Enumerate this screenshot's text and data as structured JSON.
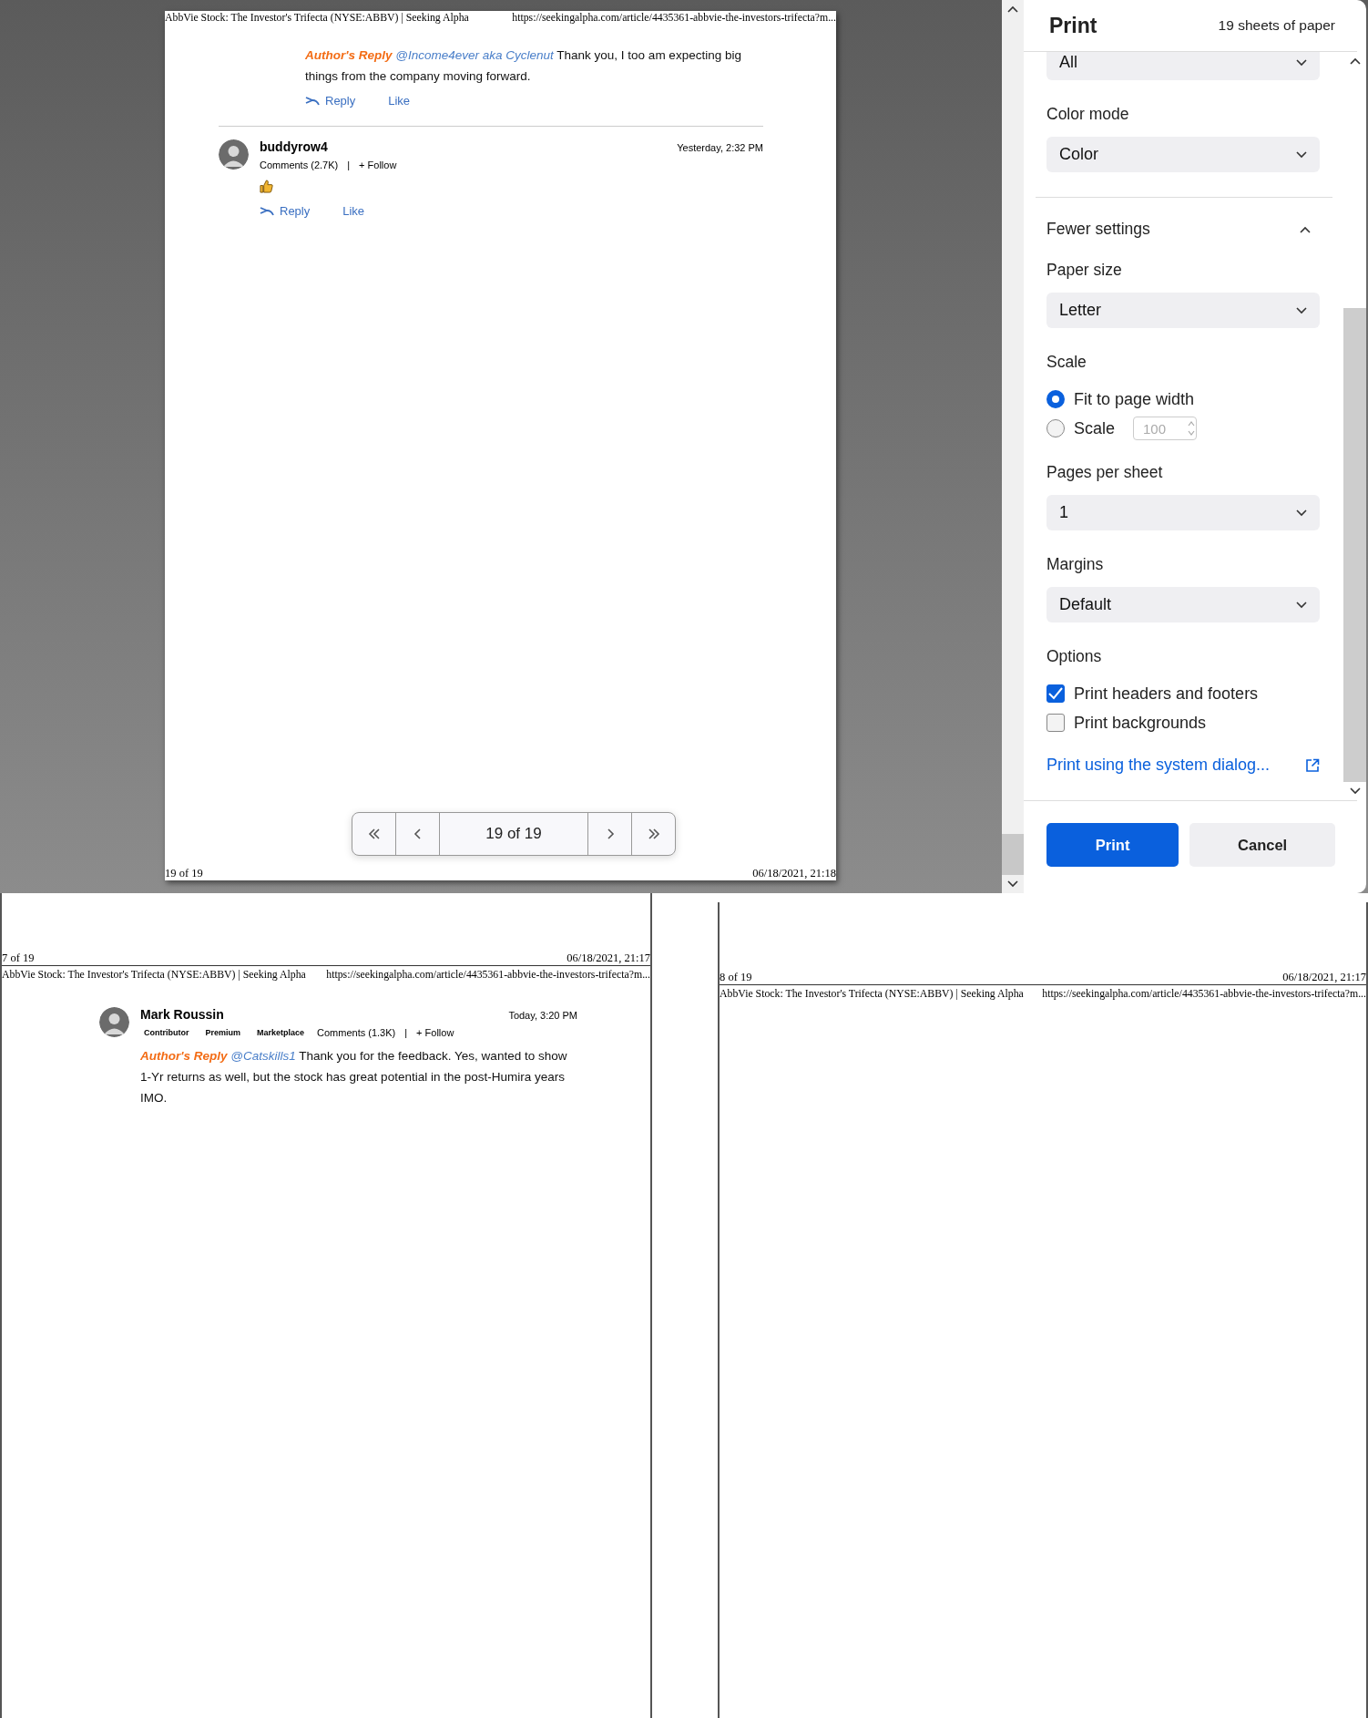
{
  "preview": {
    "header_title": "AbbVie Stock: The Investor's Trifecta (NYSE:ABBV) | Seeking Alpha",
    "header_url": "https://seekingalpha.com/article/4435361-abbvie-the-investors-trifecta?m...",
    "comments": [
      {
        "kind": "continuation",
        "nested": true,
        "tag": "Author's Reply",
        "mention": "@Income4ever aka Cyclenut",
        "text": "Thank you, I too am expecting big things from the company moving forward.",
        "actions": [
          {
            "kind": "reply",
            "label": "Reply"
          },
          {
            "kind": "like",
            "label": "Like"
          }
        ]
      },
      {
        "kind": "reaction",
        "nested": false,
        "author": "buddyrow4",
        "time": "Yesterday, 2:32 PM",
        "stats": "Comments (2.7K)",
        "separator": "|",
        "follow": "+ Follow",
        "actions": [
          {
            "kind": "reply",
            "label": "Reply"
          },
          {
            "kind": "like",
            "label": "Like"
          }
        ]
      }
    ],
    "pager": {
      "label": "19 of 19"
    },
    "footer_page": "19 of 19",
    "footer_date": "06/18/2021, 21:18"
  },
  "print_panel": {
    "title": "Print",
    "sheets": "19 sheets of paper",
    "sections": [
      {
        "kind": "select",
        "value": "All"
      },
      {
        "kind": "select",
        "label": "Color mode",
        "value": "Color"
      },
      {
        "kind": "toggle",
        "label": "Fewer settings",
        "expanded": true
      },
      {
        "kind": "select",
        "label": "Paper size",
        "value": "Letter"
      },
      {
        "kind": "radios",
        "label": "Scale",
        "options": [
          {
            "label": "Fit to page width",
            "selected": true
          },
          {
            "label": "Scale",
            "selected": false,
            "value": "100",
            "disabled": true
          }
        ]
      },
      {
        "kind": "select",
        "label": "Pages per sheet",
        "value": "1"
      },
      {
        "kind": "select",
        "label": "Margins",
        "value": "Default"
      },
      {
        "kind": "checkboxes",
        "label": "Options",
        "items": [
          {
            "label": "Print headers and footers",
            "checked": true
          },
          {
            "label": "Print backgrounds",
            "checked": false
          }
        ]
      },
      {
        "kind": "link",
        "label": "Print using the system dialog..."
      }
    ],
    "buttons": [
      {
        "kind": "primary",
        "label": "Print"
      },
      {
        "kind": "secondary",
        "label": "Cancel"
      }
    ]
  },
  "background_pages": [
    {
      "footer_page": "7 of 19",
      "footer_date": "06/18/2021, 21:17",
      "header_title": "AbbVie Stock: The Investor's Trifecta (NYSE:ABBV) | Seeking Alpha",
      "header_url": "https://seekingalpha.com/article/4435361-abbvie-the-investors-trifecta?m...",
      "comments": [
        {
          "kind": "text",
          "nested": true,
          "author": "Mark Roussin",
          "time": "Today, 3:20 PM",
          "badges": [
            "Contributor",
            "Premium",
            "Marketplace"
          ],
          "stats": "Comments (1.3K)",
          "separator": "|",
          "follow": "+ Follow",
          "tag": "Author's Reply",
          "mention": "@Catskills1",
          "text": "Thank you for the feedback. Yes, wanted to show 1-Yr returns as well, but the stock has great potential in the post-Humira years IMO."
        }
      ]
    },
    {
      "footer_page": "8 of 19",
      "footer_date": "06/18/2021, 21:17",
      "header_title": "AbbVie Stock: The Investor's Trifecta (NYSE:ABBV) | Seeking Alpha",
      "header_url": "https://seekingalpha.com/article/4435361-abbvie-the-investors-trifecta?m..."
    }
  ]
}
